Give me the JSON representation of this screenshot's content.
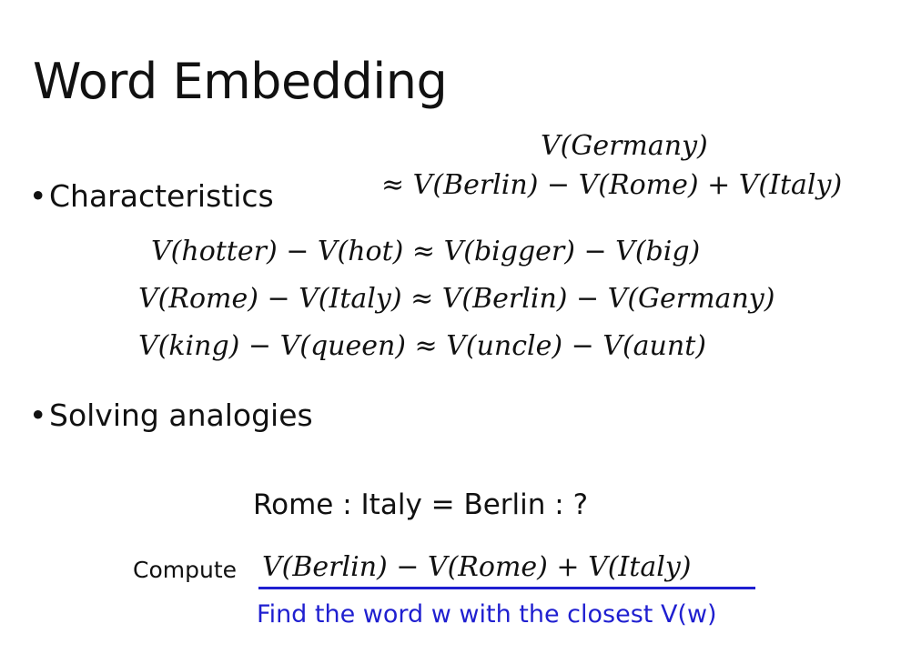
{
  "title": "Word Embedding",
  "bullets": {
    "symbol": "•",
    "characteristics": "Characteristics",
    "solving": "Solving analogies"
  },
  "equations": {
    "germany_lhs": "V(Germany)",
    "germany_rhs": "≈ V(Berlin) − V(Rome) + V(Italy)",
    "eq1": "V(hotter) − V(hot) ≈ V(bigger) − V(big)",
    "eq2": "V(Rome) − V(Italy) ≈ V(Berlin) − V(Germany)",
    "eq3": "V(king) − V(queen) ≈ V(uncle) − V(aunt)"
  },
  "analogy": "Rome : Italy = Berlin : ?",
  "compute": {
    "label": "Compute",
    "expression": "V(Berlin) − V(Rome) + V(Italy)",
    "find_text": "Find the word w with the closest V(w)"
  },
  "colors": {
    "text": "#111111",
    "accent_blue": "#1f1fd0",
    "background": "#ffffff"
  }
}
